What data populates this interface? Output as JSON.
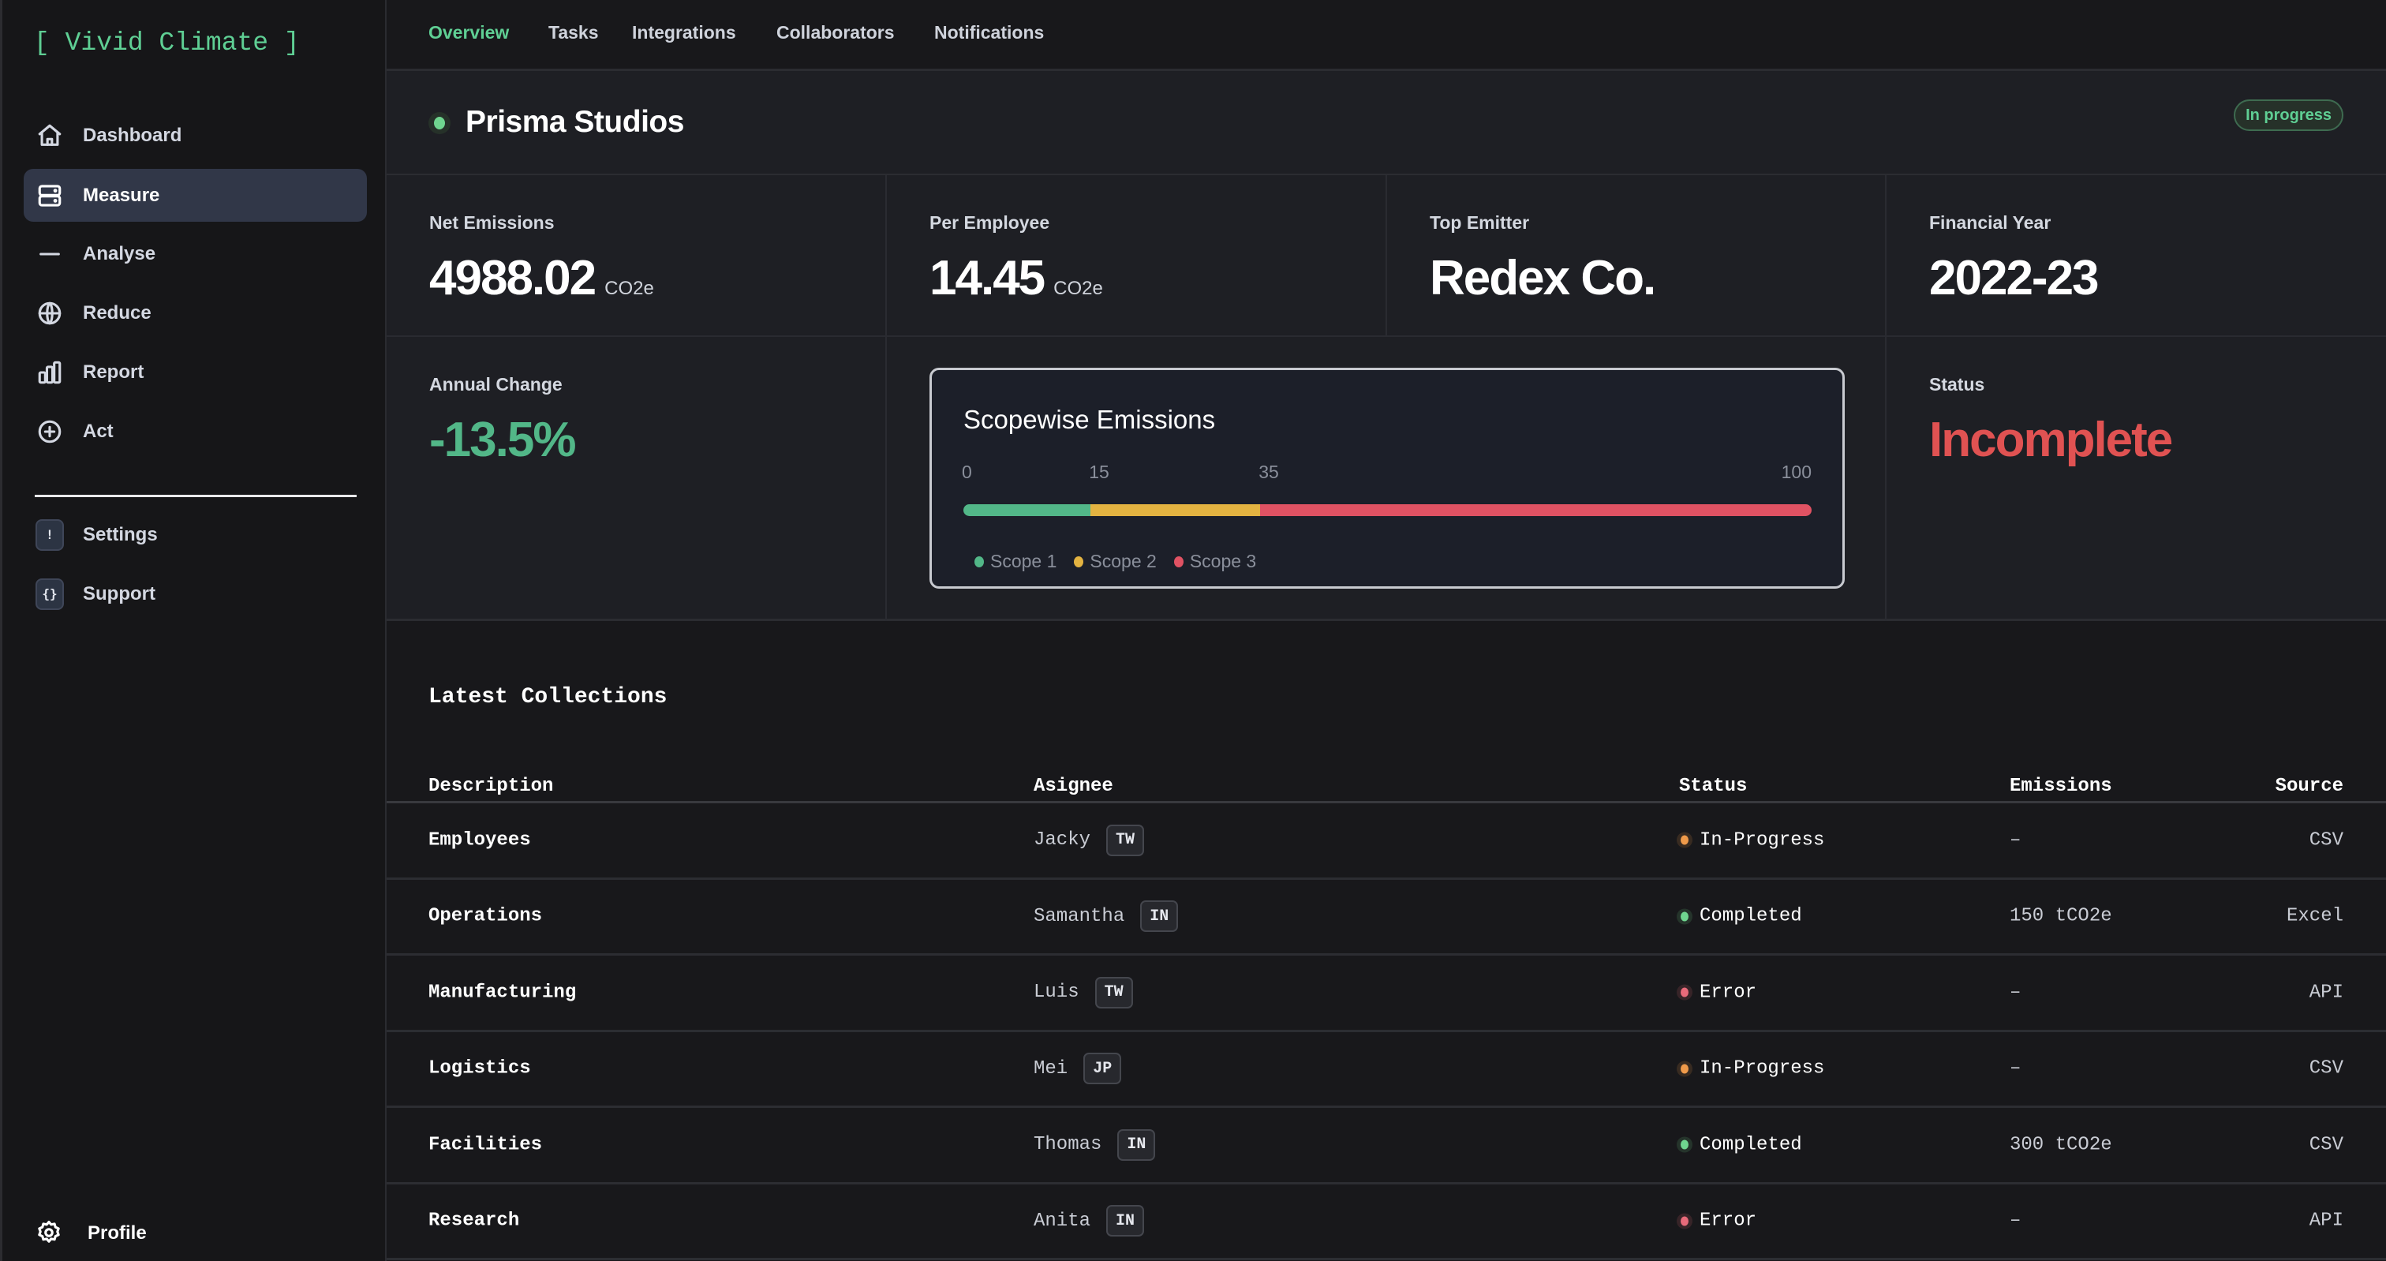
{
  "app": {
    "logo": "[ Vivid Climate ]"
  },
  "sidebar": {
    "items": [
      {
        "label": "Dashboard",
        "icon": "home-icon",
        "active": false
      },
      {
        "label": "Measure",
        "icon": "server-icon",
        "active": true
      },
      {
        "label": "Analyse",
        "icon": "minus-icon",
        "active": false
      },
      {
        "label": "Reduce",
        "icon": "globe-icon",
        "active": false
      },
      {
        "label": "Report",
        "icon": "bar-chart-icon",
        "active": false
      },
      {
        "label": "Act",
        "icon": "plus-circle-icon",
        "active": false
      }
    ],
    "secondary": [
      {
        "label": "Settings",
        "icon_glyph": "!",
        "icon": "exclamation-icon"
      },
      {
        "label": "Support",
        "icon_glyph": "{}",
        "icon": "braces-icon"
      }
    ],
    "profile": {
      "label": "Profile",
      "icon": "gear-icon"
    }
  },
  "tabs": [
    {
      "label": "Overview",
      "active": true
    },
    {
      "label": "Tasks",
      "active": false
    },
    {
      "label": "Integrations",
      "active": false
    },
    {
      "label": "Collaborators",
      "active": false
    },
    {
      "label": "Notifications",
      "active": false
    }
  ],
  "header": {
    "title": "Prisma Studios",
    "badge": "In progress",
    "status_color": "#6fd58f"
  },
  "stats": {
    "net_emissions": {
      "label": "Net Emissions",
      "value": "4988.02",
      "unit": "CO2e"
    },
    "per_employee": {
      "label": "Per Employee",
      "value": "14.45",
      "unit": "CO2e"
    },
    "top_emitter": {
      "label": "Top Emitter",
      "value": "Redex Co."
    },
    "financial_year": {
      "label": "Financial Year",
      "value": "2022-23"
    },
    "annual_change": {
      "label": "Annual Change",
      "value": "-13.5%",
      "color": "#52b788"
    },
    "status": {
      "label": "Status",
      "value": "Incomplete",
      "color": "#e05252"
    }
  },
  "chart_data": {
    "type": "bar",
    "title": "Scopewise Emissions",
    "orientation": "horizontal-stacked",
    "ticks": [
      "0",
      "15",
      "35",
      "100"
    ],
    "xlim": [
      0,
      100
    ],
    "series": [
      {
        "name": "Scope 1",
        "start": 0,
        "end": 15,
        "value": 15,
        "color": "#52b788"
      },
      {
        "name": "Scope 2",
        "start": 15,
        "end": 35,
        "value": 20,
        "color": "#e3b341"
      },
      {
        "name": "Scope 3",
        "start": 35,
        "end": 100,
        "value": 65,
        "color": "#e05263"
      }
    ],
    "legend_position": "bottom-left"
  },
  "collections": {
    "title": "Latest Collections",
    "columns": [
      "Description",
      "Asignee",
      "Status",
      "Emissions",
      "Source"
    ],
    "status_colors": {
      "In-Progress": "#ef9a4a",
      "Completed": "#6fd58f",
      "Error": "#e86a7a"
    },
    "rows": [
      {
        "description": "Employees",
        "assignee": "Jacky",
        "country": "TW",
        "status": "In-Progress",
        "emissions": "–",
        "source": "CSV"
      },
      {
        "description": "Operations",
        "assignee": "Samantha",
        "country": "IN",
        "status": "Completed",
        "emissions": "150 tCO2e",
        "source": "Excel"
      },
      {
        "description": "Manufacturing",
        "assignee": "Luis",
        "country": "TW",
        "status": "Error",
        "emissions": "–",
        "source": "API"
      },
      {
        "description": "Logistics",
        "assignee": "Mei",
        "country": "JP",
        "status": "In-Progress",
        "emissions": "–",
        "source": "CSV"
      },
      {
        "description": "Facilities",
        "assignee": "Thomas",
        "country": "IN",
        "status": "Completed",
        "emissions": "300 tCO2e",
        "source": "CSV"
      },
      {
        "description": "Research",
        "assignee": "Anita",
        "country": "IN",
        "status": "Error",
        "emissions": "–",
        "source": "API"
      }
    ]
  }
}
